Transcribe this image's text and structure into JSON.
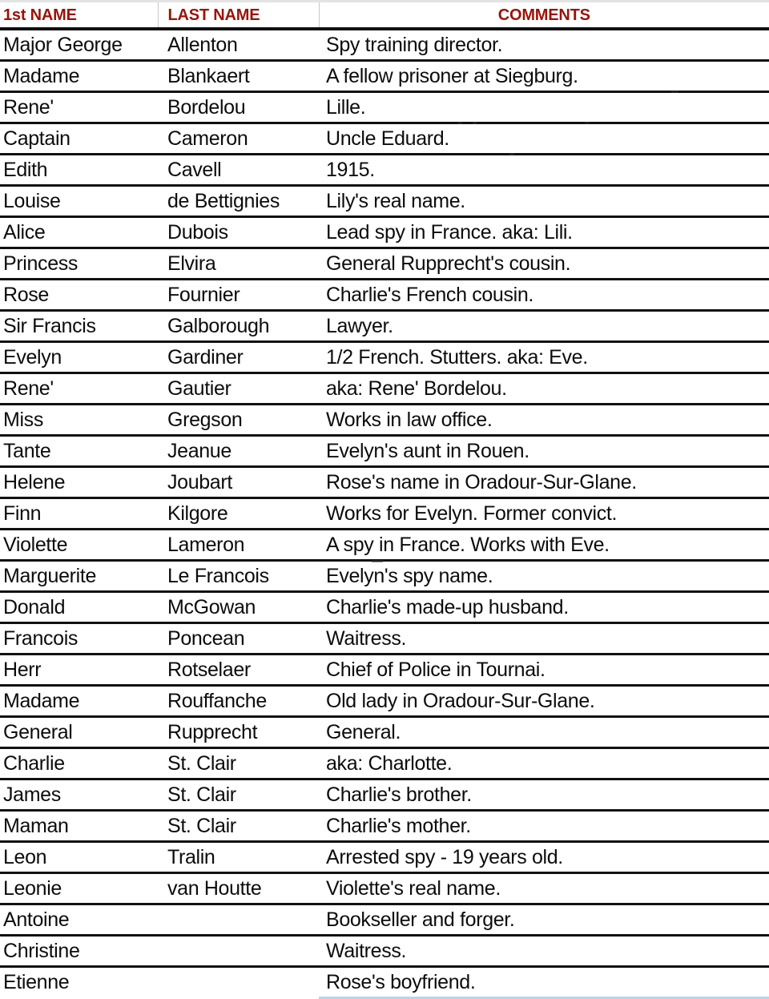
{
  "table": {
    "columns": [
      {
        "key": "first_name",
        "label": "1st NAME",
        "align": "left"
      },
      {
        "key": "last_name",
        "label": "LAST NAME",
        "align": "left"
      },
      {
        "key": "comments",
        "label": "COMMENTS",
        "align": "center"
      }
    ],
    "header_text_color": "#9c1206",
    "body_text_color": "#0c0c0c",
    "rule_color": "#111111",
    "accent_underline_color": "#b9d4f0",
    "row_count": 30,
    "rows": [
      {
        "first_name": "Major George",
        "last_name": "Allenton",
        "comments": "Spy training director."
      },
      {
        "first_name": "Madame",
        "last_name": "Blankaert",
        "comments": "A fellow prisoner at Siegburg."
      },
      {
        "first_name": "Rene'",
        "last_name": "Bordelou",
        "comments": "Lille."
      },
      {
        "first_name": "Captain",
        "last_name": "Cameron",
        "comments": "Uncle Eduard."
      },
      {
        "first_name": "Edith",
        "last_name": "Cavell",
        "comments": "1915."
      },
      {
        "first_name": "Louise",
        "last_name": "de Bettignies",
        "comments": "Lily's real name."
      },
      {
        "first_name": "Alice",
        "last_name": "Dubois",
        "comments": "Lead spy in France. aka: Lili."
      },
      {
        "first_name": "Princess",
        "last_name": "Elvira",
        "comments": "General Rupprecht's cousin."
      },
      {
        "first_name": "Rose",
        "last_name": "Fournier",
        "comments": "Charlie's French cousin."
      },
      {
        "first_name": "Sir Francis",
        "last_name": "Galborough",
        "comments": "Lawyer."
      },
      {
        "first_name": "Evelyn",
        "last_name": "Gardiner",
        "comments": "1/2 French. Stutters. aka: Eve."
      },
      {
        "first_name": "Rene'",
        "last_name": "Gautier",
        "comments": "aka: Rene' Bordelou."
      },
      {
        "first_name": "Miss",
        "last_name": "Gregson",
        "comments": "Works in law office."
      },
      {
        "first_name": "Tante",
        "last_name": "Jeanue",
        "comments": "Evelyn's aunt in Rouen."
      },
      {
        "first_name": "Helene",
        "last_name": "Joubart",
        "comments": "Rose's name in Oradour-Sur-Glane."
      },
      {
        "first_name": "Finn",
        "last_name": "Kilgore",
        "comments": "Works for Evelyn. Former convict."
      },
      {
        "first_name": "Violette",
        "last_name": "Lameron",
        "comments": "A spy in France. Works with Eve."
      },
      {
        "first_name": "Marguerite",
        "last_name": "Le Francois",
        "comments": "Evelyn's spy name."
      },
      {
        "first_name": "Donald",
        "last_name": "McGowan",
        "comments": "Charlie's made-up husband."
      },
      {
        "first_name": "Francois",
        "last_name": "Poncean",
        "comments": "Waitress."
      },
      {
        "first_name": "Herr",
        "last_name": "Rotselaer",
        "comments": "Chief of Police in Tournai."
      },
      {
        "first_name": "Madame",
        "last_name": "Rouffanche",
        "comments": "Old lady in Oradour-Sur-Glane."
      },
      {
        "first_name": "General",
        "last_name": "Rupprecht",
        "comments": "General."
      },
      {
        "first_name": "Charlie",
        "last_name": "St. Clair",
        "comments": "aka: Charlotte."
      },
      {
        "first_name": "James",
        "last_name": "St. Clair",
        "comments": "Charlie's brother."
      },
      {
        "first_name": "Maman",
        "last_name": "St. Clair",
        "comments": "Charlie's mother."
      },
      {
        "first_name": "Leon",
        "last_name": "Tralin",
        "comments": "Arrested spy - 19 years old."
      },
      {
        "first_name": "Leonie",
        "last_name": "van Houtte",
        "comments": "Violette's real name."
      },
      {
        "first_name": "Antoine",
        "last_name": "",
        "comments": "Bookseller and forger."
      },
      {
        "first_name": "Christine",
        "last_name": "",
        "comments": "Waitress."
      },
      {
        "first_name": "Etienne",
        "last_name": "",
        "comments": "Rose's boyfriend."
      }
    ]
  }
}
